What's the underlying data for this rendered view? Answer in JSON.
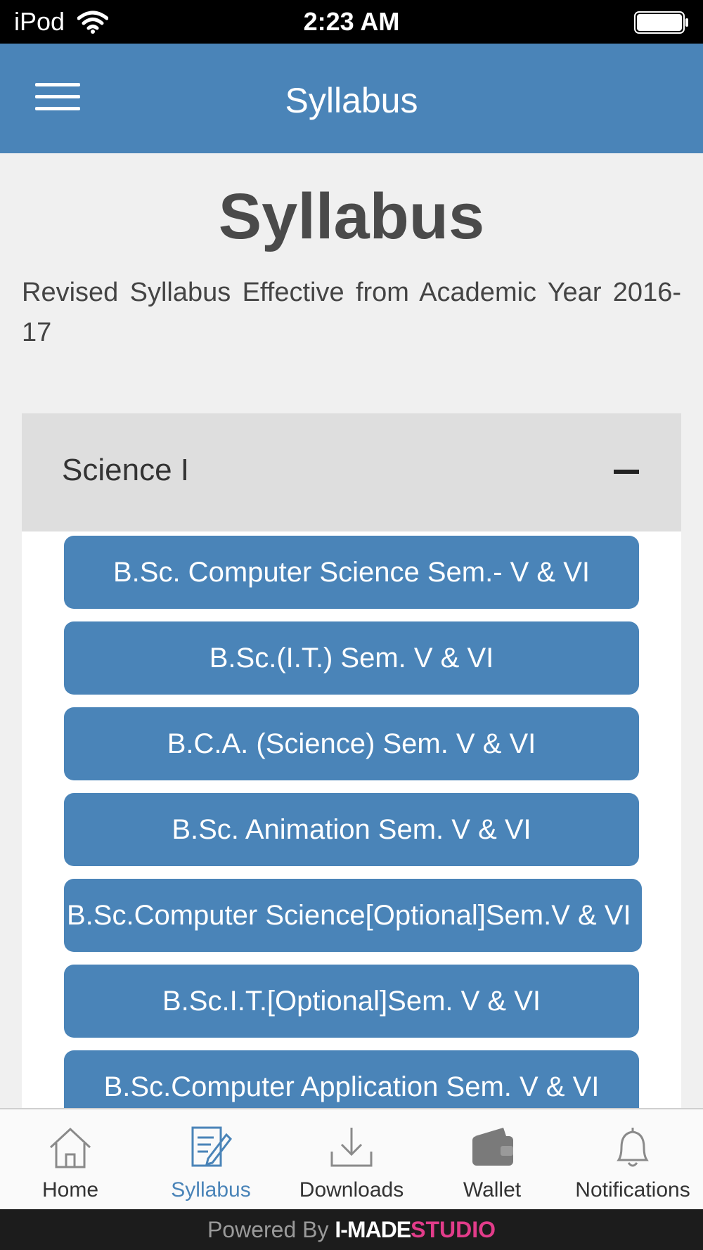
{
  "status_bar": {
    "carrier": "iPod",
    "time": "2:23 AM",
    "wifi_icon": "wifi-icon",
    "battery_icon": "battery-full-icon"
  },
  "nav_bar": {
    "title": "Syllabus",
    "menu_icon": "hamburger-menu-icon"
  },
  "main": {
    "heading": "Syllabus",
    "intro": "Revised Syllabus Effective from Academic Year 2016-17",
    "accordion": {
      "title": "Science I",
      "toggle_icon": "collapse-minus-icon",
      "items": [
        {
          "label": "B.Sc. Computer Science Sem.- V & VI"
        },
        {
          "label": "B.Sc.(I.T.) Sem. V & VI"
        },
        {
          "label": "B.C.A. (Science) Sem. V & VI"
        },
        {
          "label": "B.Sc. Animation Sem. V & VI"
        },
        {
          "label": "B.Sc.Computer Science[Optional]Sem.V & VI"
        },
        {
          "label": "B.Sc.I.T.[Optional]Sem. V & VI"
        },
        {
          "label": "B.Sc.Computer Application Sem. V & VI"
        }
      ]
    }
  },
  "tab_bar": {
    "active": "Syllabus",
    "tabs": [
      {
        "label": "Home",
        "icon": "home-icon"
      },
      {
        "label": "Syllabus",
        "icon": "document-edit-icon"
      },
      {
        "label": "Downloads",
        "icon": "download-icon"
      },
      {
        "label": "Wallet",
        "icon": "wallet-icon"
      },
      {
        "label": "Notifications",
        "icon": "bell-icon"
      }
    ]
  },
  "footer": {
    "powered": "Powered By",
    "brand": "I-MADE",
    "studio": "STUDIO"
  },
  "colors": {
    "primary": "#4a84b8",
    "accordion_header": "#dedede",
    "background": "#f0f0f0",
    "studio_accent": "#e23c8a"
  }
}
